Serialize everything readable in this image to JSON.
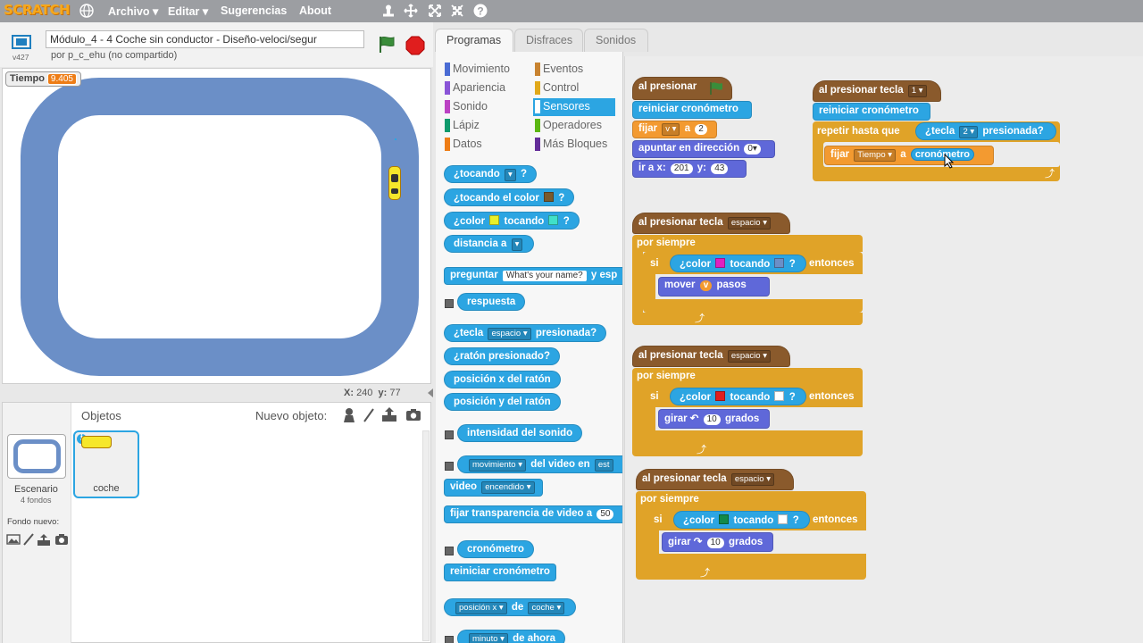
{
  "menubar": {
    "logo": "SCRATCH",
    "items": [
      "Archivo ▾",
      "Editar ▾",
      "Sugerencias",
      "About"
    ]
  },
  "stage": {
    "version": "v427",
    "title": "Módulo_4 - 4 Coche sin conductor - Diseño-veloci/segur",
    "author": "por p_c_ehu (no compartido)",
    "monitor": {
      "label": "Tiempo",
      "value": "9.405"
    },
    "x_label": "X:",
    "x": "240",
    "y_label": "y:",
    "y": "77"
  },
  "sprites": {
    "header": "Objetos",
    "new_label": "Nuevo objeto:",
    "stage_name": "Escenario",
    "stage_sub": "4 fondos",
    "backdrop_label": "Fondo nuevo:",
    "sprite_name": "coche"
  },
  "tabs": [
    "Programas",
    "Disfraces",
    "Sonidos"
  ],
  "categories": [
    "Movimiento",
    "Apariencia",
    "Sonido",
    "Lápiz",
    "Datos",
    "Eventos",
    "Control",
    "Sensores",
    "Operadores",
    "Más Bloques"
  ],
  "colors": {
    "motion": "#4a6cd4",
    "looks": "#8a55d7",
    "sound": "#bb42c3",
    "pen": "#0e9a6c",
    "data": "#ee7d16",
    "events": "#c88330",
    "control": "#e1a91a",
    "sensing": "#2ca5e2",
    "operators": "#5cb712",
    "more": "#632d99"
  },
  "palette": {
    "b1": [
      "¿tocando",
      "▾",
      "?"
    ],
    "b2": [
      "¿tocando el color",
      "?"
    ],
    "b3": [
      "¿color",
      "tocando",
      "?"
    ],
    "b4": [
      "distancia a",
      "▾"
    ],
    "b5": [
      "preguntar",
      "What's your name?",
      "y esp"
    ],
    "b6": "respuesta",
    "b7": [
      "¿tecla",
      "espacio ▾",
      "presionada?"
    ],
    "b8": "¿ratón presionado?",
    "b9": "posición x del ratón",
    "b10": "posición y del ratón",
    "b11": "intensidad del sonido",
    "b12": [
      "movimiento ▾",
      "del video en",
      "est"
    ],
    "b13": [
      "video",
      "encendido ▾"
    ],
    "b14": [
      "fijar transparencia de video a",
      "50"
    ],
    "b15": "cronómetro",
    "b16": "reiniciar cronómetro",
    "b17": [
      "posición x ▾",
      "de",
      "coche ▾"
    ],
    "b18": [
      "minuto ▾",
      "de ahora"
    ]
  },
  "scripts": {
    "s1": {
      "hat": "al presionar",
      "reset": "reiniciar cronómetro",
      "set": [
        "fijar",
        "v ▾",
        "a",
        "2"
      ],
      "point": [
        "apuntar en dirección",
        "0▾"
      ],
      "goto": [
        "ir a x:",
        "201",
        "y:",
        "43"
      ]
    },
    "s2": {
      "hat": [
        "al presionar tecla",
        "1 ▾"
      ],
      "reset": "reiniciar cronómetro",
      "repeat": [
        "repetir hasta que",
        "¿tecla",
        "2 ▾",
        "presionada?"
      ],
      "set": [
        "fijar",
        "Tiempo ▾",
        "a",
        "cronómetro"
      ]
    },
    "s3": {
      "hat": [
        "al presionar tecla",
        "espacio ▾"
      ],
      "forever": "por siempre",
      "if": [
        "si",
        "¿color",
        "tocando",
        "?",
        "entonces"
      ],
      "move": [
        "mover",
        "v",
        "pasos"
      ]
    },
    "s4": {
      "hat": [
        "al presionar tecla",
        "espacio ▾"
      ],
      "forever": "por siempre",
      "if": [
        "si",
        "¿color",
        "tocando",
        "?",
        "entonces"
      ],
      "turn": [
        "girar ↶",
        "10",
        "grados"
      ]
    },
    "s5": {
      "hat": [
        "al presionar tecla",
        "espacio ▾"
      ],
      "forever": "por siempre",
      "if": [
        "si",
        "¿color",
        "tocando",
        "?",
        "entonces"
      ],
      "turn": [
        "girar ↷",
        "10",
        "grados"
      ]
    }
  }
}
